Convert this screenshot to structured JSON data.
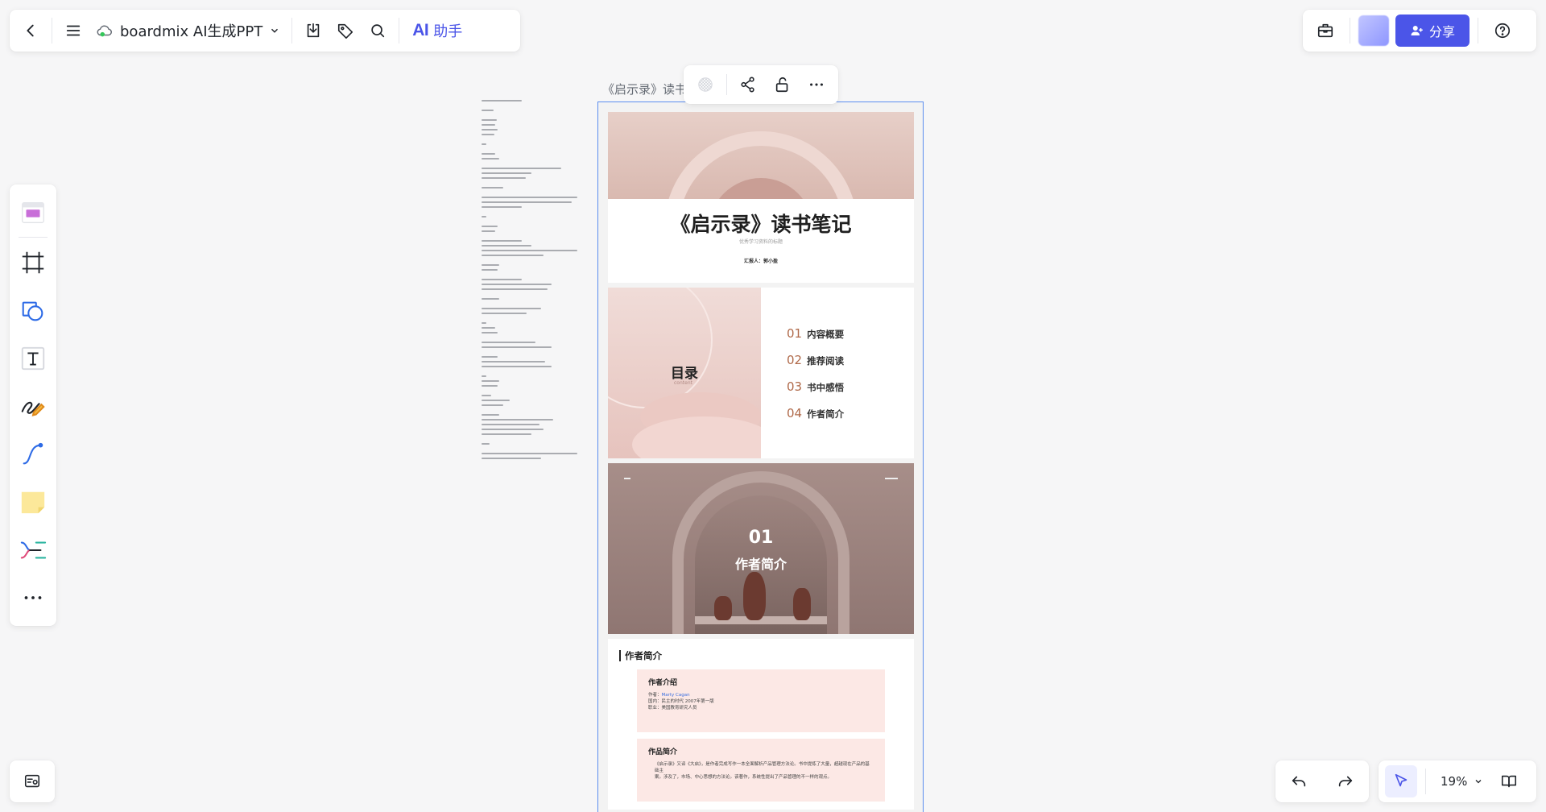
{
  "toolbar": {
    "doc_title": "boardmix AI生成PPT",
    "ai_label_prefix": "AI",
    "ai_label": "助手"
  },
  "header_right": {
    "share_label": "分享"
  },
  "canvas": {
    "frame_label": "《启示录》读书",
    "slides": {
      "cover": {
        "title": "《启示录》读书笔记",
        "subtitle": "优秀学习资料的标题",
        "reporter": "汇报人：郭小盈"
      },
      "toc": {
        "title": "目录",
        "subtitle": "content",
        "items": [
          {
            "num": "01",
            "text": "内容概要"
          },
          {
            "num": "02",
            "text": "推荐阅读"
          },
          {
            "num": "03",
            "text": "书中感悟"
          },
          {
            "num": "04",
            "text": "作者简介"
          }
        ]
      },
      "section": {
        "number": "01",
        "title": "作者简介"
      },
      "author": {
        "heading": "作者简介",
        "card_author_title": "作者介绍",
        "card_author_line1_label": "作者：",
        "card_author_line1_link": "Marty Cagan",
        "card_author_line2": "国内：民主的时代 2007年第一版",
        "card_author_line3": "职业：美国教育研究人员",
        "card_work_title": "作品简介",
        "card_work_line1": "《启示录》又译《大启》，是作者完成写作一本全面解析产品管理方法论。书中提炼了大量，超越现在产品的基础主",
        "card_work_line2": "案。涉及了，市场、中心思想的方法论。该著作，系统性提出了产品管理的不一样的观点。"
      }
    }
  },
  "bottom": {
    "zoom_level": "19%"
  },
  "colors": {
    "accent": "#4b55e8",
    "selection": "#5b8def",
    "toc_number": "#b06a4a"
  }
}
